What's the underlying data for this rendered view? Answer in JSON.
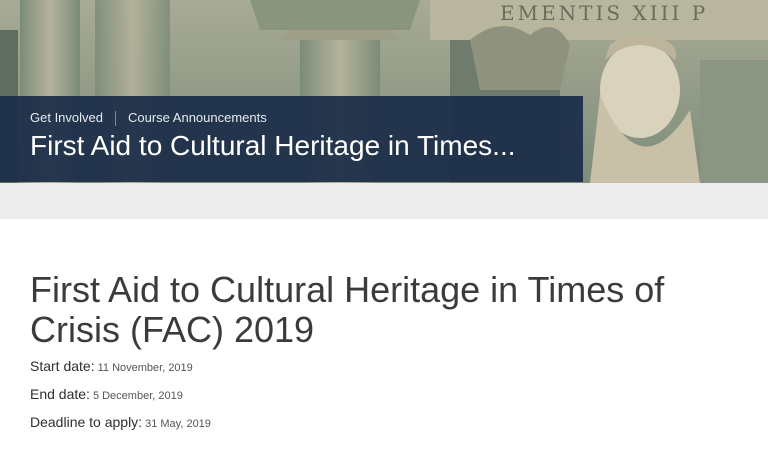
{
  "breadcrumb": {
    "items": [
      "Get Involved",
      "Course Announcements"
    ]
  },
  "banner": {
    "title": "First Aid to Cultural Heritage in Times..."
  },
  "hero": {
    "inscription": "EMENTIS XIII P"
  },
  "page": {
    "title": "First Aid to Cultural Heritage in Times of Crisis (FAC) 2019"
  },
  "details": [
    {
      "label": "Start date:",
      "value": "11 November, 2019"
    },
    {
      "label": "End date:",
      "value": "5 December, 2019"
    },
    {
      "label": "Deadline to apply:",
      "value": "31 May, 2019"
    }
  ],
  "colors": {
    "banner_bg": "#1b2d48",
    "title_text": "#3b3b3b"
  }
}
